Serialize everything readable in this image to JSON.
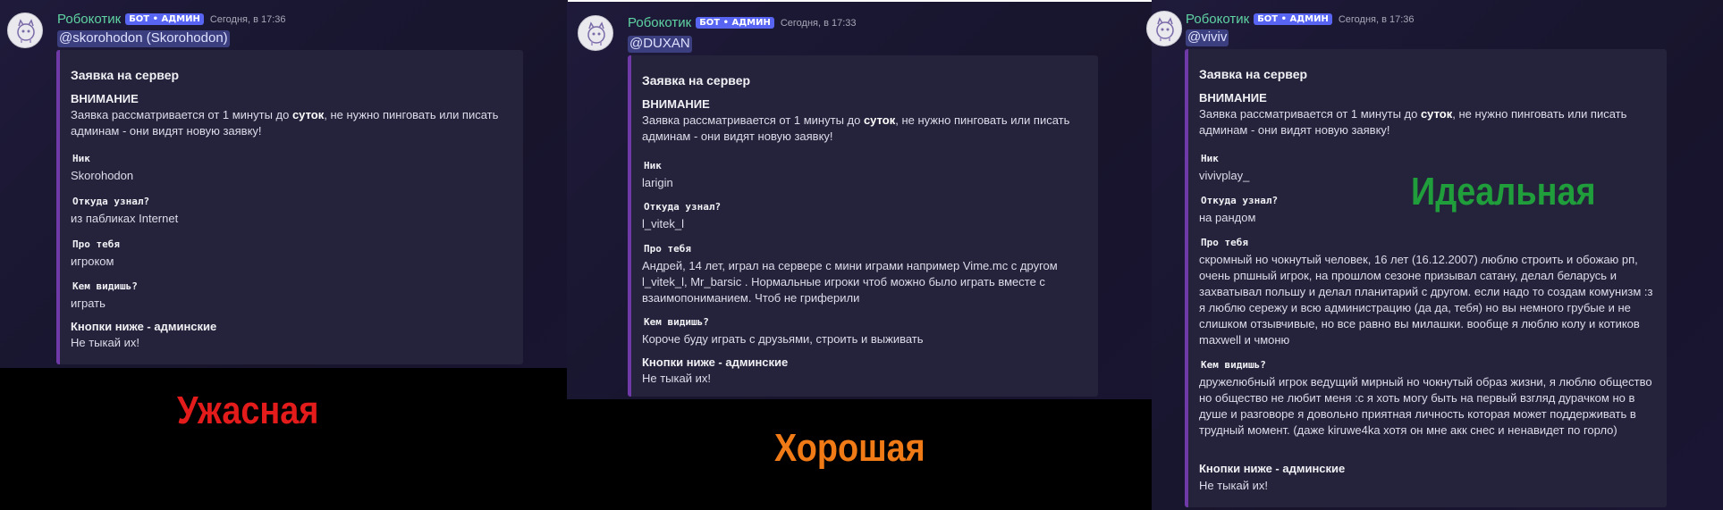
{
  "common": {
    "author": "Робокотик",
    "bot_tag": "БОТ • АДМИН",
    "embed_title": "Заявка на сервер",
    "warning_title": "ВНИМАНИЕ",
    "warning_part1": "Заявка рассматривается от 1 минуты до ",
    "warning_bold": "суток",
    "warning_part2": ", не нужно пинговать или писать админам - они видят новую заявку!",
    "label_nick": "Ник",
    "label_source": "Откуда узнал?",
    "label_about": "Про тебя",
    "label_role": "Кем видишь?",
    "admin_title": "Кнопки ниже - админские",
    "admin_text": "Не тыкай их!"
  },
  "messages": [
    {
      "timestamp": "Сегодня, в 17:36",
      "mention": "@skorohodon (Skorohodon)",
      "nick": "Skorohodon",
      "source": "из пабликах Internet",
      "about": "игроком",
      "role": "играть",
      "verdict": "Ужасная"
    },
    {
      "timestamp": "Сегодня, в 17:33",
      "mention": "@DUXAN",
      "nick": "larigin",
      "source": "l_vitek_l",
      "about": "Андрей, 14 лет, играл на сервере с мини играми например Vime.mc с другом l_vitek_l, Mr_barsic . Нормальные игроки чтоб можно было играть вместе с взаимопониманием. Чтоб не гриферили",
      "role": "Короче буду играть с друзьями, строить и выживать",
      "verdict": "Хорошая"
    },
    {
      "timestamp": "Сегодня, в 17:36",
      "mention": "@viviv",
      "nick": "vivivplay_",
      "source": "на рандом",
      "about": "скромный но чокнутый человек, 16 лет (16.12.2007) люблю строить и обожаю рп, очень рпшный игрок, на прошлом сезоне призывал сатану, делал беларусь и захватывал польшу и делал планитарий с другом. если надо то создам комунизм :з я люблю сережу и всю администрацию (да да, тебя) но вы немного грубые и не слишком отзывчивые, но все равно вы милашки. вообще я люблю колу и котиков maxwell и чмоню",
      "role": "дружелюбный игрок ведущий мирный но чокнутый образ жизни, я люблю общество но общество не любит меня :с я хоть могу быть на первый взгляд дурачком но в душе и разговоре я довольно приятная личность которая может поддерживать в трудный момент. (даже kiruwe4ka хотя он мне акк снес и ненавидет по горло)",
      "verdict": "Идеальная"
    }
  ],
  "colors": {
    "author": "#5fd3a3",
    "bot_tag": "#5865f2",
    "embed_border": "#6f3aa8",
    "verdict_bad": "#e41b1b",
    "verdict_good": "#f07a15",
    "verdict_ideal": "#1f9e3b"
  },
  "icons": {
    "avatar": "robot-cat-avatar-icon"
  }
}
